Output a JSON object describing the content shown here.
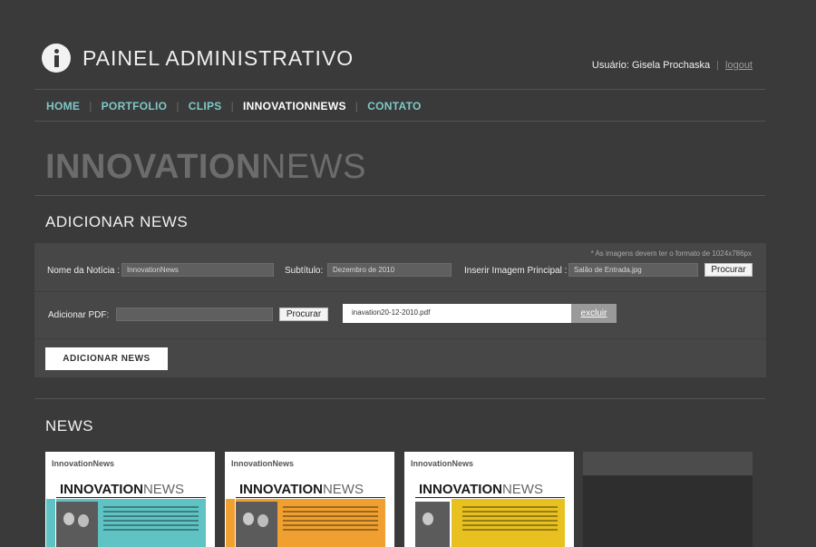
{
  "header": {
    "app_title": "PAINEL ADMINISTRATIVO",
    "user_label": "Usuário: Gisela Prochaska",
    "separator": "|",
    "logout_label": "logout"
  },
  "nav": {
    "items": [
      {
        "label": "HOME"
      },
      {
        "label": "PORTFOLIO"
      },
      {
        "label": "CLIPS"
      },
      {
        "label": "INNOVATIONNEWS"
      },
      {
        "label": "CONTATO"
      }
    ],
    "separator": "|",
    "active": "INNOVATIONNEWS"
  },
  "page_title": {
    "bold": "INNOVATION",
    "light": "NEWS"
  },
  "add_section": {
    "title": "ADICIONAR NEWS",
    "image_note": "* As imagens devem ter o formato de 1024x786px",
    "news_name_label": "Nome da Notícia :",
    "news_name_value": "InnovationNews",
    "subtitle_label": "Subtítulo:",
    "subtitle_value": "Dezembro de 2010",
    "main_image_label": "Inserir Imagem Principal :",
    "main_image_value": "Salão de Entrada.jpg",
    "browse_label": "Procurar",
    "pdf_label": "Adicionar PDF:",
    "pdf_browse_label": "Procurar",
    "pdf_file": "inavation20-12-2010.pdf",
    "remove_label": "excluir",
    "add_button": "ADICIONAR NEWS"
  },
  "news_section": {
    "title": "NEWS",
    "cards": [
      {
        "label": "InnovationNews",
        "head_bold": "INNOVATION",
        "head_light": "NEWS",
        "accent": "#5fc3c3"
      },
      {
        "label": "InnovationNews",
        "head_bold": "INNOVATION",
        "head_light": "NEWS",
        "accent": "#f0a030"
      },
      {
        "label": "InnovationNews",
        "head_bold": "INNOVATION",
        "head_light": "NEWS",
        "accent": "#e8c020"
      }
    ]
  },
  "colors": {
    "background": "#3a3a3a",
    "nav_link": "#7fc8c8",
    "nav_active": "#ffffff",
    "panel": "#474747"
  }
}
